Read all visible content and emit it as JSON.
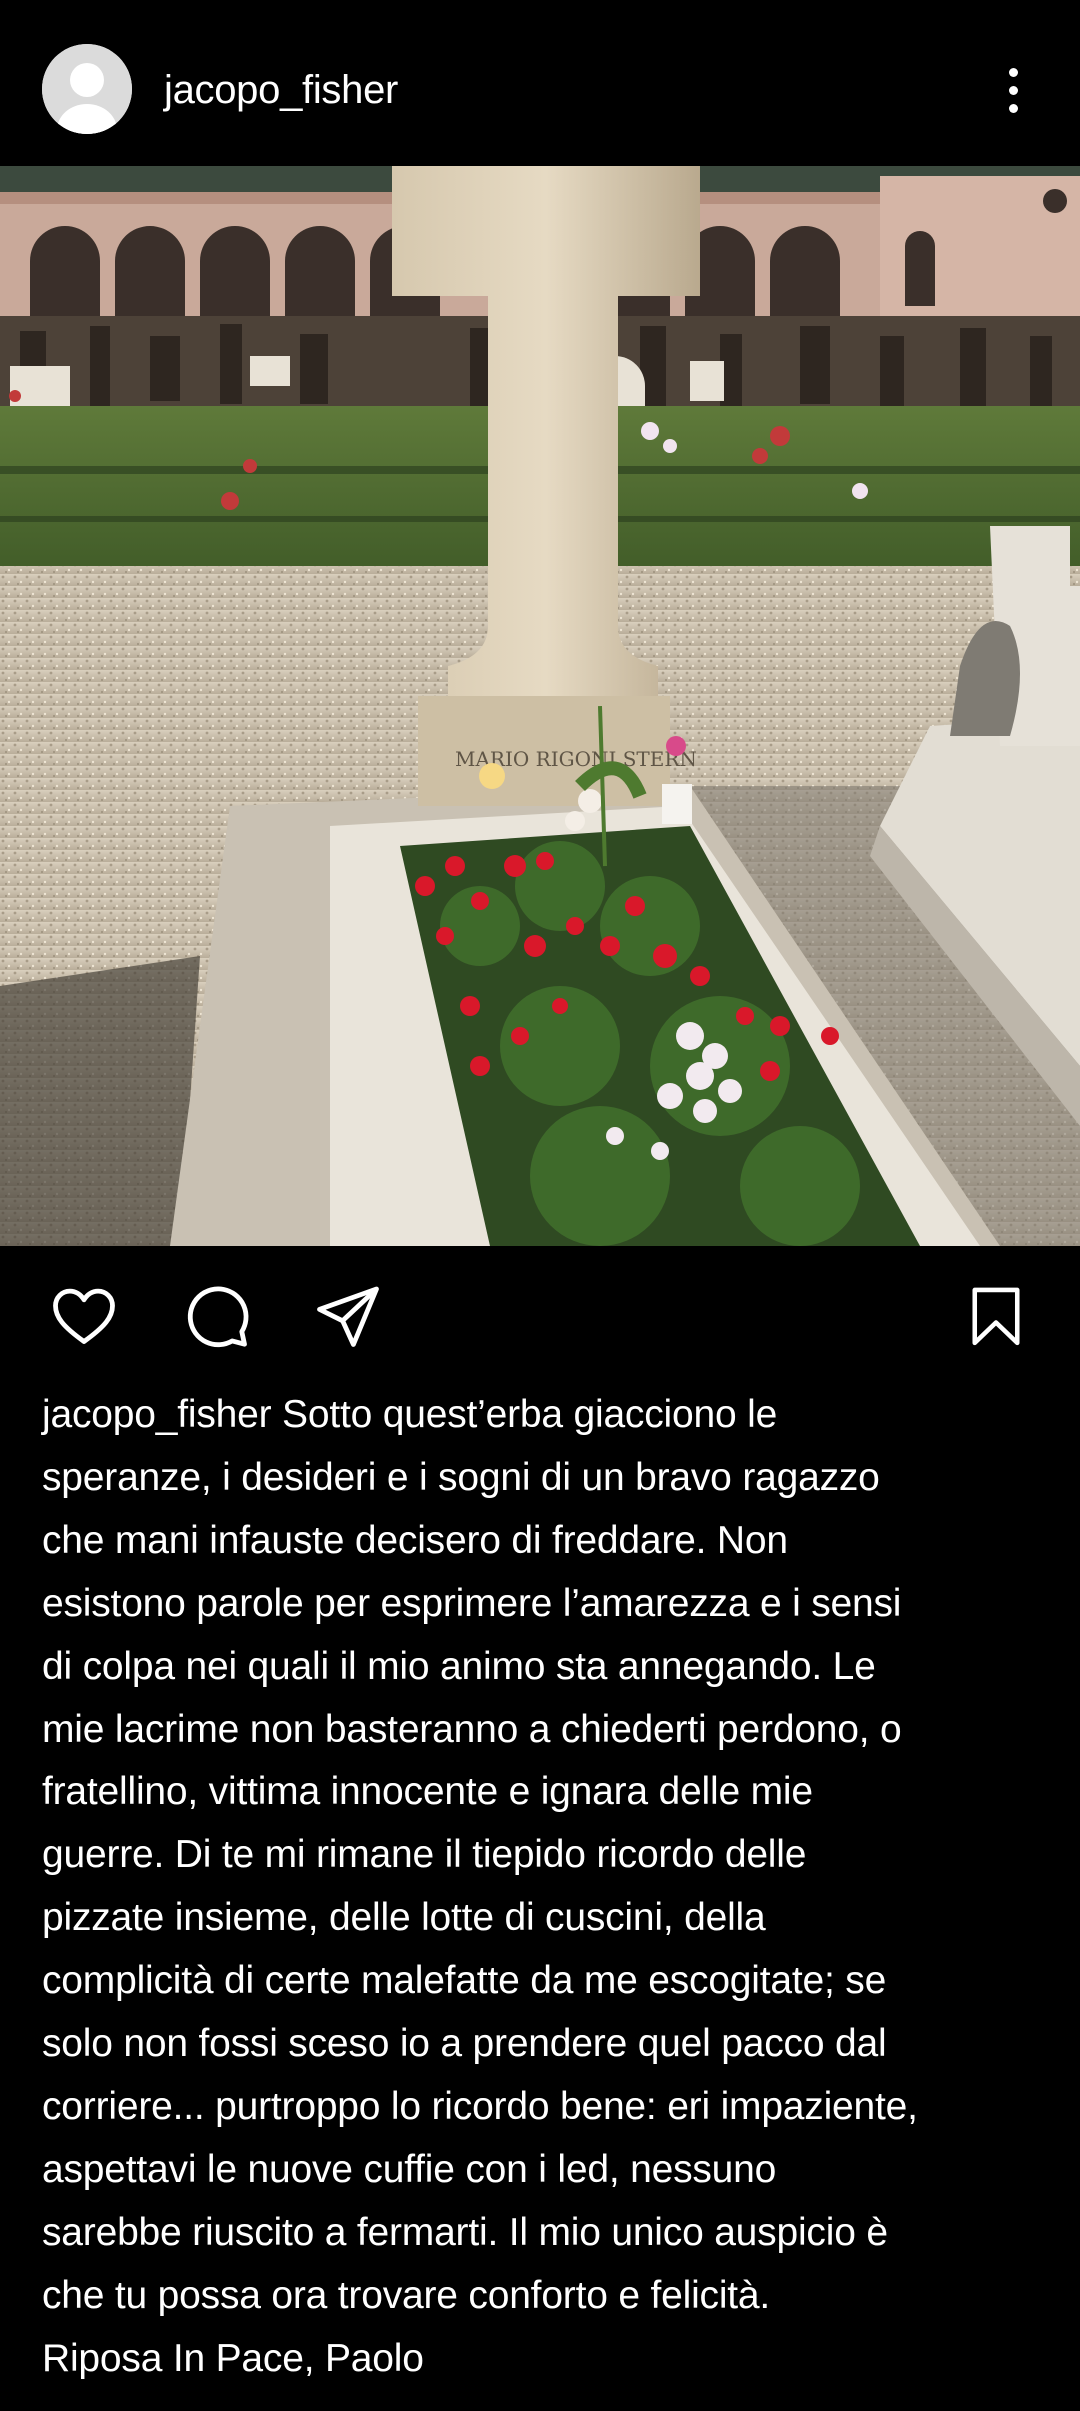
{
  "header": {
    "username": "jacopo_fisher",
    "avatar_icon": "default-avatar-icon",
    "more_icon": "more-vertical-icon"
  },
  "post": {
    "image_description_icon": "photo",
    "actions": {
      "like_icon": "heart-icon",
      "comment_icon": "comment-icon",
      "share_icon": "send-icon",
      "save_icon": "bookmark-icon"
    }
  },
  "caption": {
    "username": "jacopo_fisher",
    "first_line_rest": " Sotto quest’erba giacciono le",
    "lines": [
      "speranze, i desideri e i sogni di un bravo ragazzo",
      "che mani infauste decisero di freddare. Non",
      "esistono parole per esprimere l’amarezza e i sensi",
      "di colpa nei quali il mio animo sta annegando. Le",
      "mie lacrime non basteranno a chiederti perdono, o",
      "fratellino, vittima innocente e ignara delle mie",
      "guerre. Di te mi rimane il tiepido ricordo delle",
      "pizzate insieme, delle lotte di cuscini, della",
      "complicità di certe malefatte da me escogitate; se",
      "solo non fossi sceso io a prendere quel pacco dal",
      "corriere... purtroppo lo ricordo bene: eri impaziente,",
      "aspettavi le nuove cuffie con i led, nessuno",
      "sarebbe riuscito a fermarti. Il mio unico auspicio è",
      "che tu possa ora trovare conforto e felicità.",
      "Riposa In Pace, Paolo"
    ]
  },
  "colors": {
    "background": "#000000",
    "text": "#ffffff",
    "avatar_bg": "#dbdbdb"
  },
  "photo_engraving": "MARIO RIGONI STERN"
}
